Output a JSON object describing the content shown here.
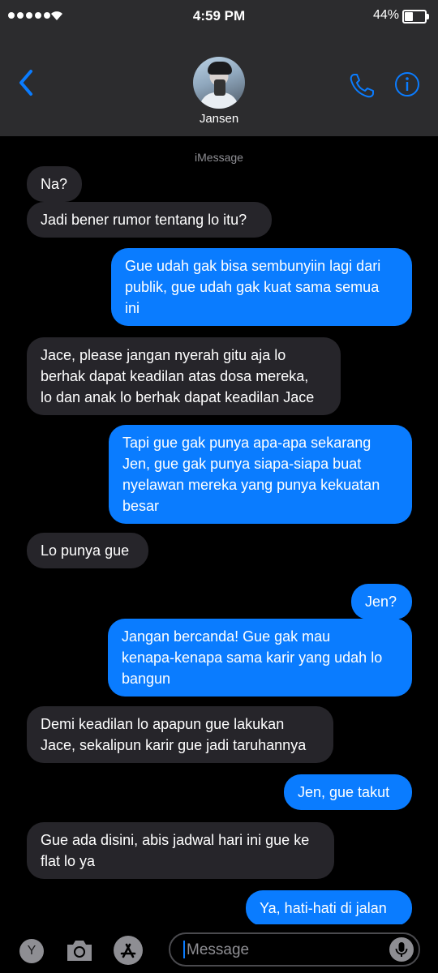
{
  "status": {
    "time": "4:59 PM",
    "battery": "44%",
    "battery_level": 0.44
  },
  "contact": {
    "name": "Jansen"
  },
  "service_label": "iMessage",
  "messages": [
    {
      "from": "them",
      "text": "Na?"
    },
    {
      "from": "them",
      "text": "Jadi bener rumor tentang lo itu?"
    },
    {
      "from": "me",
      "text": "Gue udah gak bisa sembunyiin lagi dari\npublik, gue udah gak kuat sama semua\nini"
    },
    {
      "from": "them",
      "text": "Jace, please jangan nyerah gitu aja lo\nberhak dapat keadilan atas dosa mereka,\nlo dan anak lo berhak dapat keadilan Jace"
    },
    {
      "from": "me",
      "text": "Tapi gue gak punya apa-apa sekarang\nJen, gue gak punya siapa-siapa buat\nnyelawan mereka yang punya kekuatan\nbesar"
    },
    {
      "from": "them",
      "text": "Lo punya gue"
    },
    {
      "from": "me",
      "text": "Jen?"
    },
    {
      "from": "me",
      "text": "Jangan bercanda! Gue gak mau\nkenapa-kenapa sama karir yang udah lo\nbangun"
    },
    {
      "from": "them",
      "text": "Demi keadilan lo apapun gue lakukan\nJace, sekalipun karir gue jadi taruhannya"
    },
    {
      "from": "me",
      "text": "Jen, gue takut"
    },
    {
      "from": "them",
      "text": "Gue ada disini, abis jadwal hari ini gue ke\nflat lo ya"
    },
    {
      "from": "me",
      "text": "Ya, hati-hati di jalan"
    }
  ],
  "input": {
    "placeholder": "Message"
  },
  "app_drawer": {
    "y_app_label": "Y"
  },
  "icons": [
    "back-chevron-icon",
    "phone-icon",
    "info-icon",
    "camera-icon",
    "app-store-icon",
    "microphone-icon"
  ],
  "colors": {
    "accent": "#0a7cff",
    "incoming_bubble": "#26252a",
    "header_bg": "#2c2c2e"
  }
}
